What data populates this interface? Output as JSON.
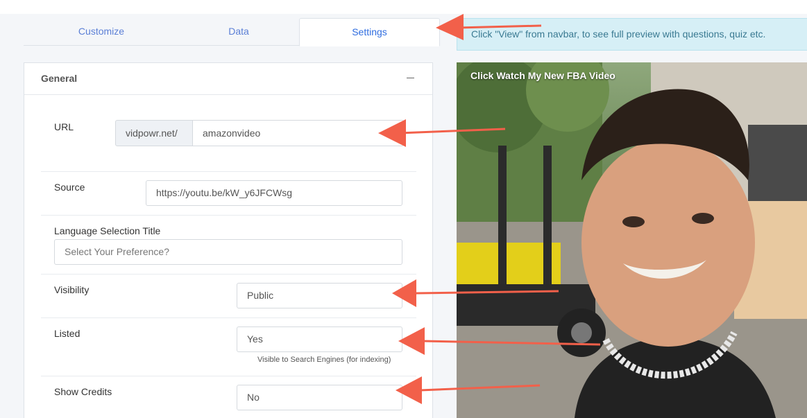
{
  "tabs": [
    {
      "label": "Customize"
    },
    {
      "label": "Data"
    },
    {
      "label": "Settings",
      "active": true
    }
  ],
  "notice": "Click \"View\" from navbar, to see full preview with questions, quiz etc.",
  "panel": {
    "title": "General",
    "url": {
      "label": "URL",
      "prefix": "vidpowr.net/",
      "value": "amazonvideo"
    },
    "source": {
      "label": "Source",
      "value": "https://youtu.be/kW_y6JFCWsg"
    },
    "language": {
      "label": "Language Selection Title",
      "placeholder": "Select Your Preference?"
    },
    "visibility": {
      "label": "Visibility",
      "value": "Public"
    },
    "listed": {
      "label": "Listed",
      "value": "Yes",
      "hint": "Visible to Search Engines (for indexing)"
    },
    "credits": {
      "label": "Show Credits",
      "value": "No"
    }
  },
  "video": {
    "title": "Click Watch My New FBA Video"
  },
  "colors": {
    "accent": "#2f6de0",
    "arrow": "#f2604a",
    "notice_bg": "#d6eff6"
  }
}
